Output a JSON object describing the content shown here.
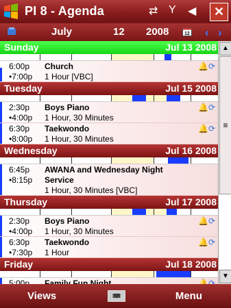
{
  "titlebar": {
    "title": "PI 8 - Agenda",
    "status_icons": [
      "network-icon",
      "signal-icon",
      "volume-icon"
    ],
    "close": "✕"
  },
  "datenav": {
    "month": "July",
    "day": "12",
    "year": "2008"
  },
  "days": [
    {
      "name": "Sunday",
      "date": "Jul 13 2008",
      "today": true,
      "appts": [
        {
          "start": "6:00p",
          "end": "•7:00p",
          "subject": "Church",
          "details": [
            "1 Hour [VBC]"
          ]
        }
      ]
    },
    {
      "name": "Tuesday",
      "date": "Jul 15 2008",
      "today": false,
      "appts": [
        {
          "start": "2:30p",
          "end": "•4:00p",
          "subject": "Boys Piano",
          "details": [
            "1 Hour, 30 Minutes"
          ]
        },
        {
          "start": "6:30p",
          "end": "•8:00p",
          "subject": "Taekwondo",
          "details": [
            "1 Hour, 30 Minutes"
          ]
        }
      ]
    },
    {
      "name": "Wednesday",
      "date": "Jul 16 2008",
      "today": false,
      "appts": [
        {
          "start": "6:45p",
          "end": "•8:15p",
          "subject": "AWANA and Wednesday Night",
          "subject2": "Service",
          "details": [
            "1 Hour, 30 Minutes [VBC]"
          ]
        }
      ]
    },
    {
      "name": "Thursday",
      "date": "Jul 17 2008",
      "today": false,
      "appts": [
        {
          "start": "2:30p",
          "end": "•4:00p",
          "subject": "Boys Piano",
          "details": [
            "1 Hour, 30 Minutes"
          ]
        },
        {
          "start": "6:30p",
          "end": "•7:30p",
          "subject": "Taekwondo",
          "details": [
            "1 Hour"
          ]
        }
      ]
    },
    {
      "name": "Friday",
      "date": "Jul 18 2008",
      "today": false,
      "appts": [
        {
          "start": "5:00p",
          "end": "",
          "subject": "Family Fun Night",
          "details": []
        }
      ]
    }
  ],
  "menu": {
    "left": "Views",
    "right": "Menu"
  },
  "colors": {
    "today": "#22dd22",
    "header": "#9a2222",
    "busy": "#1a3cff",
    "free": "#fff6c8"
  }
}
